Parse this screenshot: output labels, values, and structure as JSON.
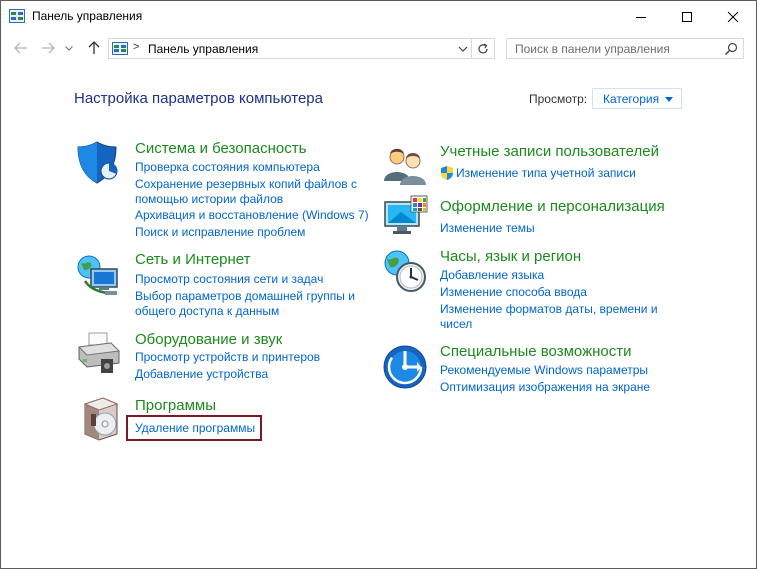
{
  "window": {
    "title": "Панель управления",
    "icons": {
      "app": "control-panel-icon",
      "minimize": "minimize-icon",
      "maximize": "maximize-icon",
      "close": "close-icon"
    }
  },
  "nav": {
    "address_separator": ">",
    "address_text": "Панель управления",
    "search_placeholder": "Поиск в панели управления"
  },
  "main": {
    "heading": "Настройка параметров компьютера",
    "view_label": "Просмотр:",
    "view_value": "Категория"
  },
  "categories": {
    "system": {
      "title": "Система и безопасность",
      "icon": "shield-security-icon",
      "links": [
        "Проверка состояния компьютера",
        "Сохранение резервных копий файлов с",
        "помощью истории файлов",
        "Архивация и восстановление (Windows 7)",
        "Поиск и исправление проблем"
      ]
    },
    "network": {
      "title": "Сеть и Интернет",
      "icon": "network-globe-icon",
      "links": [
        "Просмотр состояния сети и задач",
        "Выбор параметров домашней группы и",
        "общего доступа к данным"
      ]
    },
    "hardware": {
      "title": "Оборудование и звук",
      "icon": "printer-icon",
      "links": [
        "Просмотр устройств и принтеров",
        "Добавление устройства"
      ]
    },
    "programs": {
      "title": "Программы",
      "icon": "programs-disc-icon",
      "links": [
        "Удаление программы"
      ]
    },
    "accounts": {
      "title": "Учетные записи пользователей",
      "icon": "users-icon",
      "links": [
        "Изменение типа учетной записи"
      ]
    },
    "appearance": {
      "title": "Оформление и персонализация",
      "icon": "monitor-palette-icon",
      "links": [
        "Изменение темы"
      ]
    },
    "clock": {
      "title": "Часы, язык и регион",
      "icon": "clock-globe-icon",
      "links": [
        "Добавление языка",
        "Изменение способа ввода",
        "Изменение форматов даты, времени и",
        "чисел"
      ]
    },
    "ease": {
      "title": "Специальные возможности",
      "icon": "ease-of-access-icon",
      "links": [
        "Рекомендуемые Windows параметры",
        "Оптимизация изображения на экране"
      ]
    }
  },
  "colors": {
    "link": "#0066cc",
    "category": "#1c8a1c",
    "heading": "#1e3287",
    "highlight": "#7b1a25"
  }
}
